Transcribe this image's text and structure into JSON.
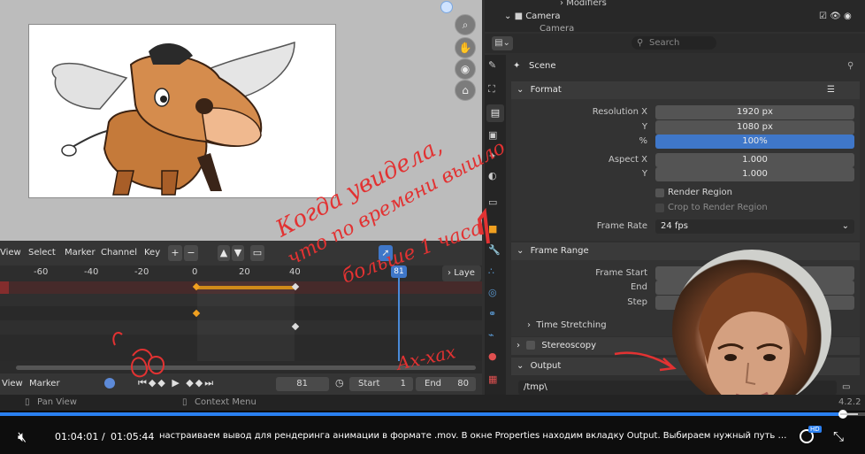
{
  "outliner": {
    "items": [
      {
        "label": "Modifiers"
      },
      {
        "label": "Camera"
      },
      {
        "label": "Camera"
      }
    ]
  },
  "properties": {
    "search_placeholder": "Search",
    "scene_label": "Scene",
    "format": {
      "title": "Format",
      "resolution_x_label": "Resolution X",
      "resolution_x": "1920 px",
      "y_label": "Y",
      "resolution_y": "1080 px",
      "pct_label": "%",
      "pct": "100%",
      "aspect_x_label": "Aspect X",
      "aspect_x": "1.000",
      "aspect_y_label": "Y",
      "aspect_y": "1.000",
      "render_region": "Render Region",
      "crop_region": "Crop to Render Region",
      "frame_rate_label": "Frame Rate",
      "frame_rate": "24 fps"
    },
    "frame_range": {
      "title": "Frame Range",
      "start_label": "Frame Start",
      "end_label": "End",
      "step_label": "Step",
      "time_stretching": "Time Stretching"
    },
    "stereoscopy": "Stereoscopy",
    "output": {
      "title": "Output",
      "path": "/tmp\\"
    },
    "version": "4.2.2"
  },
  "timeline": {
    "menus": [
      "View",
      "Select",
      "Marker",
      "Channel",
      "Key"
    ],
    "ticks": [
      "-60",
      "-40",
      "-20",
      "0",
      "20",
      "40"
    ],
    "current_frame": "81",
    "layer_button": "Laye",
    "footer_menus": [
      "View",
      "Marker"
    ],
    "footer_frame": "81",
    "start_label": "Start",
    "start": "1",
    "end_label": "End",
    "end": "80"
  },
  "status_bar": {
    "pan": "Pan View",
    "context": "Context Menu"
  },
  "annotations": {
    "line1": "Когда увидела,",
    "line2": "что по времени вышло",
    "line3": "больше 1 часа",
    "reaction": "Ах-хах"
  },
  "player": {
    "current_time": "01:04:01",
    "separator": "/",
    "total_time": "01:05:44",
    "subtitle": "настраиваем вывод для рендеринга анимации в формате .mov. В окне Properties находим вкладку Output. Выбираем нужный путь сохранения...",
    "quality_badge": "HD",
    "progress": 0.974
  },
  "colors": {
    "accent_blue": "#2a7ff0",
    "annotation_red": "#e23232",
    "blender_active": "#3f77c9"
  },
  "icons": [
    "zoom-icon",
    "hand-icon",
    "camera-icon",
    "lock-icon",
    "mute-icon",
    "settings-icon",
    "fullscreen-exit-icon",
    "search-icon"
  ]
}
